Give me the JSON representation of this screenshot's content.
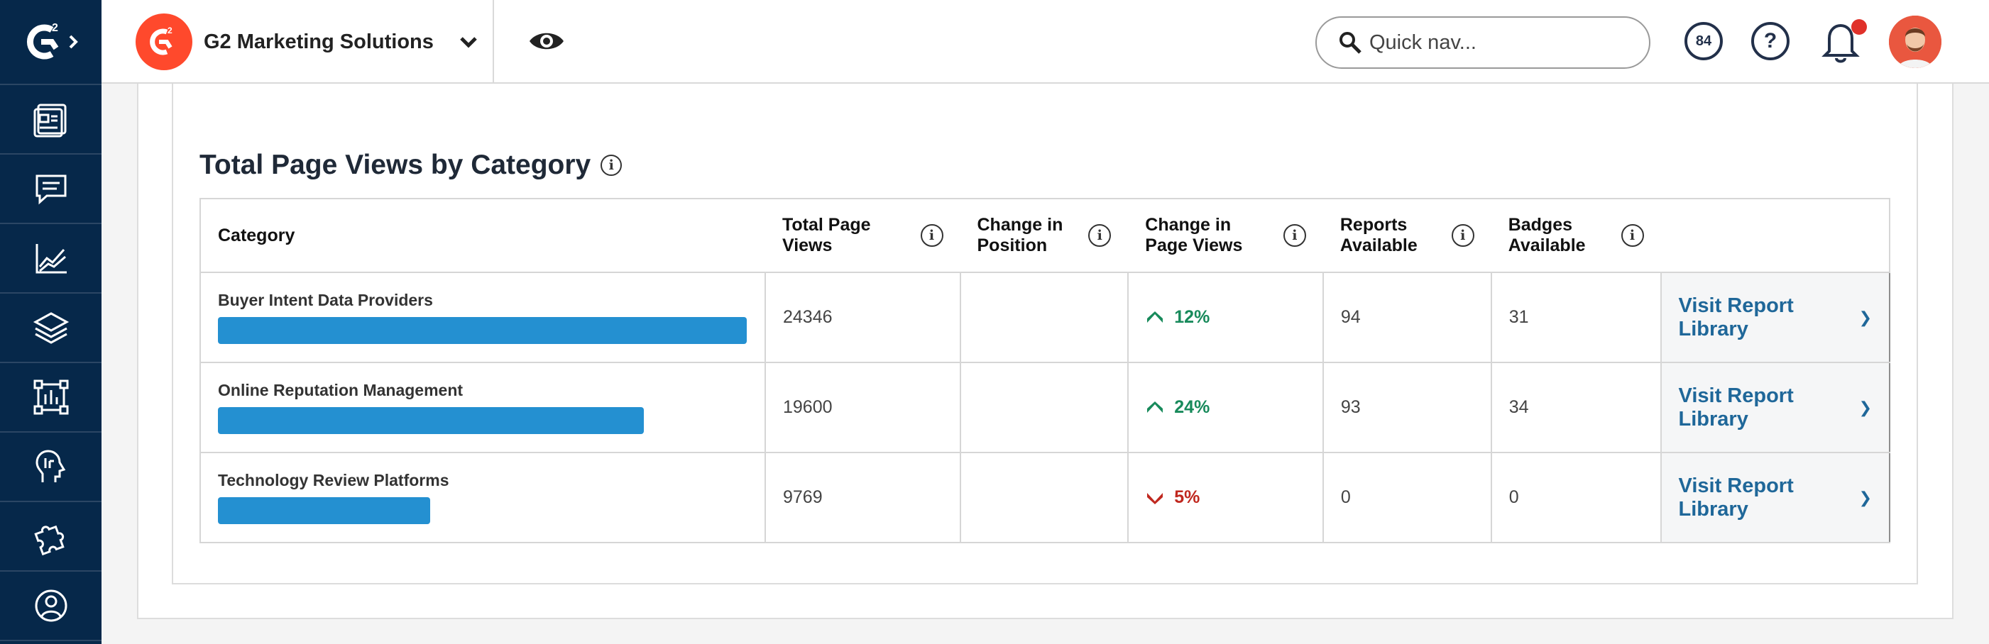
{
  "brand": {
    "name": "G2 Marketing Solutions",
    "logo_text": "G2"
  },
  "search": {
    "placeholder": "Quick nav..."
  },
  "header": {
    "score": "84",
    "help": "?"
  },
  "section": {
    "title": "Total Page Views by Category"
  },
  "table": {
    "columns": [
      "Category",
      "Total Page Views",
      "Change in Position",
      "Change in Page Views",
      "Reports Available",
      "Badges Available",
      ""
    ],
    "rows": [
      {
        "category": "Buyer Intent Data Providers",
        "page_views": "24346",
        "bar_fraction": 1.0,
        "position_change": "",
        "page_view_change": "12%",
        "direction": "up",
        "reports": "94",
        "badges": "31",
        "link": "Visit Report Library"
      },
      {
        "category": "Online Reputation Management",
        "page_views": "19600",
        "bar_fraction": 0.805,
        "position_change": "",
        "page_view_change": "24%",
        "direction": "up",
        "reports": "93",
        "badges": "34",
        "link": "Visit Report Library"
      },
      {
        "category": "Technology Review Platforms",
        "page_views": "9769",
        "bar_fraction": 0.401,
        "position_change": "",
        "page_view_change": "5%",
        "direction": "down",
        "reports": "0",
        "badges": "0",
        "link": "Visit Report Library"
      }
    ]
  },
  "colors": {
    "sidebar": "#06284a",
    "brand": "#ff492c",
    "bar": "#2490d1",
    "up": "#188a5b",
    "down": "#c0281f",
    "link": "#1f6799"
  },
  "icons": [
    "g2-logo",
    "dashboard-icon",
    "chat-icon",
    "line-chart-icon",
    "layers-icon",
    "frame-chart-icon",
    "brain-head-icon",
    "puzzle-icon",
    "user-circle-icon",
    "eye-icon",
    "search-icon",
    "bell-icon",
    "info-icon"
  ]
}
